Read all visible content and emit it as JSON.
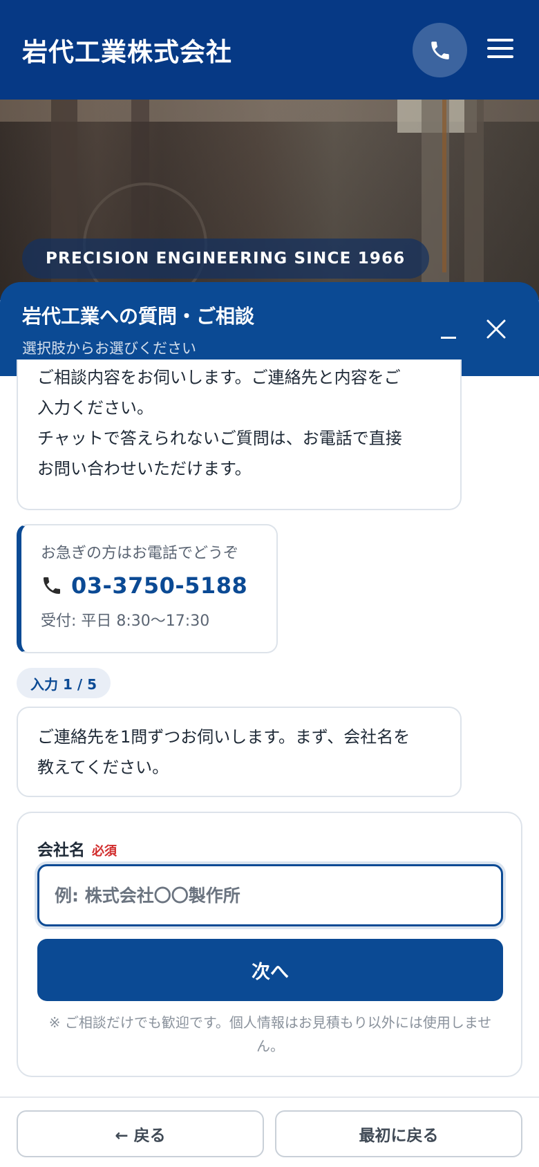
{
  "site": {
    "title": "岩代工業株式会社"
  },
  "hero": {
    "tagline": "PRECISION ENGINEERING SINCE 1966"
  },
  "chat": {
    "title": "岩代工業への質問・ご相談",
    "subtitle": "選択肢からお選びください",
    "intro_lines": [
      "ご相談内容をお伺いします。ご連絡先と内容をご",
      "入力ください。",
      "チャットで答えられないご質問は、お電話で直接",
      "お問い合わせいただけます。"
    ],
    "phone_card": {
      "label": "お急ぎの方はお電話でどうぞ",
      "number": "03-3750-5188",
      "hours": "受付: 平日 8:30〜17:30"
    },
    "step_badge": "入力 1 / 5",
    "question_lines": [
      "ご連絡先を1問ずつお伺いします。まず、会社名を",
      "教えてください。"
    ],
    "form": {
      "label": "会社名",
      "required": "必須",
      "placeholder": "例: 株式会社〇〇製作所",
      "value": "",
      "next_label": "次へ",
      "note": "※ ご相談だけでも歓迎です。個人情報はお見積もり以外には使用しません。"
    }
  },
  "footer": {
    "back_label": "← 戻る",
    "restart_label": "最初に戻る"
  },
  "colors": {
    "header_bg": "#063985",
    "accent": "#0b4a94",
    "required": "#d12b2b"
  }
}
